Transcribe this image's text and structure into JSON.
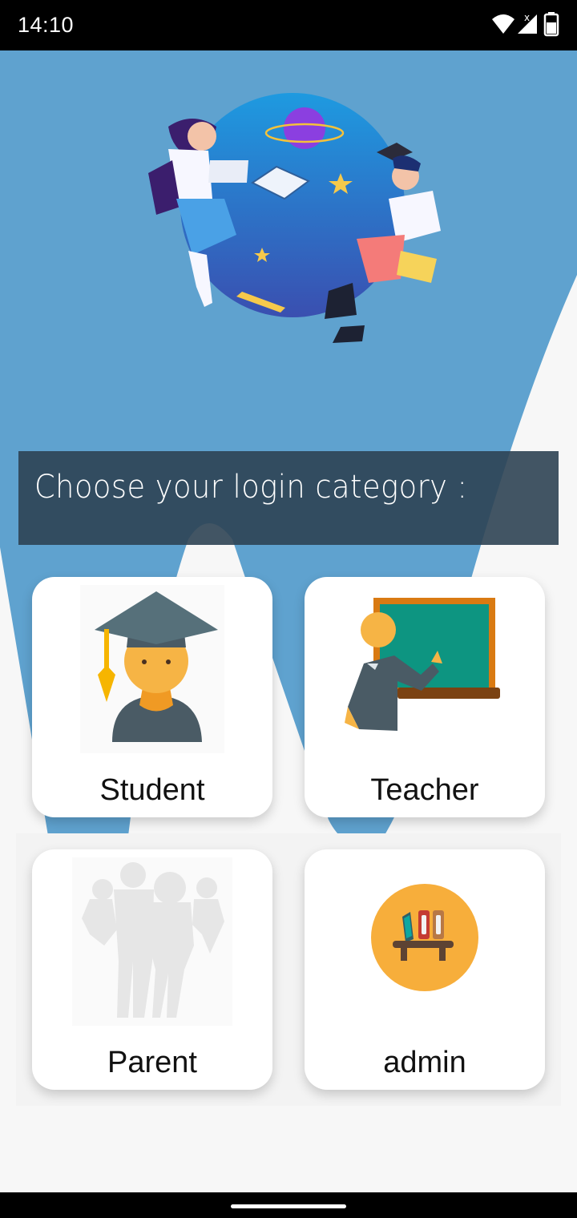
{
  "status_bar": {
    "time": "14:10",
    "icons": [
      "wifi-icon",
      "signal-icon",
      "battery-icon"
    ]
  },
  "header": {
    "prompt": "Choose your login category :"
  },
  "categories": [
    {
      "label": "Student",
      "icon": "student-icon"
    },
    {
      "label": "Teacher",
      "icon": "teacher-icon"
    },
    {
      "label": "Parent",
      "icon": "parent-icon"
    },
    {
      "label": "admin",
      "icon": "admin-icon"
    }
  ],
  "colors": {
    "sky_blue": "#5fa2cf",
    "banner": "#2d4253",
    "card": "#ffffff",
    "background": "#f7f7f7"
  }
}
